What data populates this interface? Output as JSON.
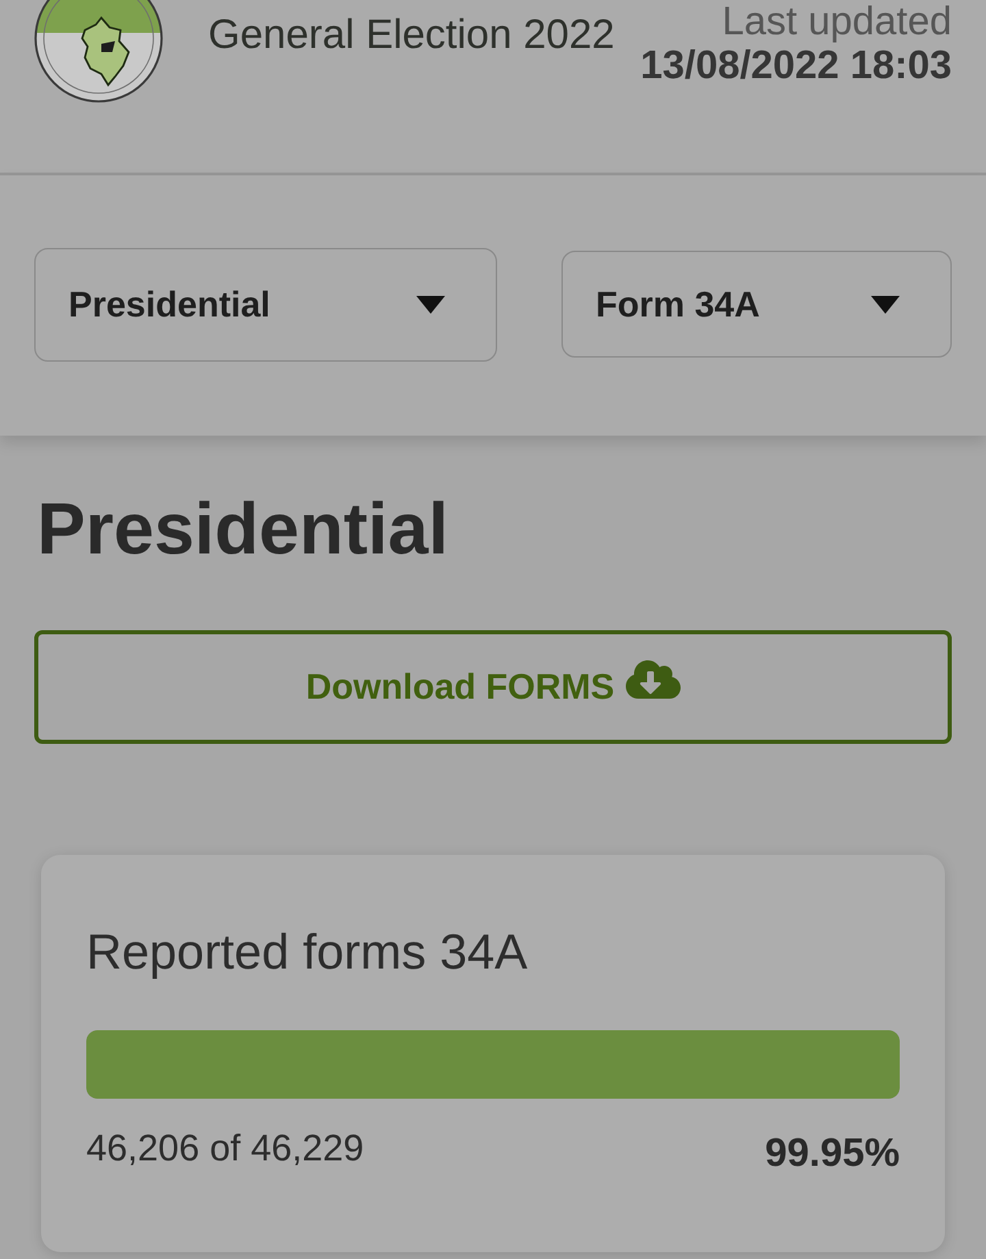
{
  "header": {
    "title": "General Election 2022",
    "last_updated_label": "Last updated",
    "last_updated": "13/08/2022 18:03"
  },
  "filters": [
    {
      "value": "Presidential"
    },
    {
      "value": "Form 34A"
    }
  ],
  "page_title": "Presidential",
  "download_button": {
    "label": "Download FORMS"
  },
  "progress_card": {
    "title": "Reported forms 34A",
    "level": 0.9995,
    "count": "46,206 of 46,229",
    "percent": "99.95%"
  }
}
